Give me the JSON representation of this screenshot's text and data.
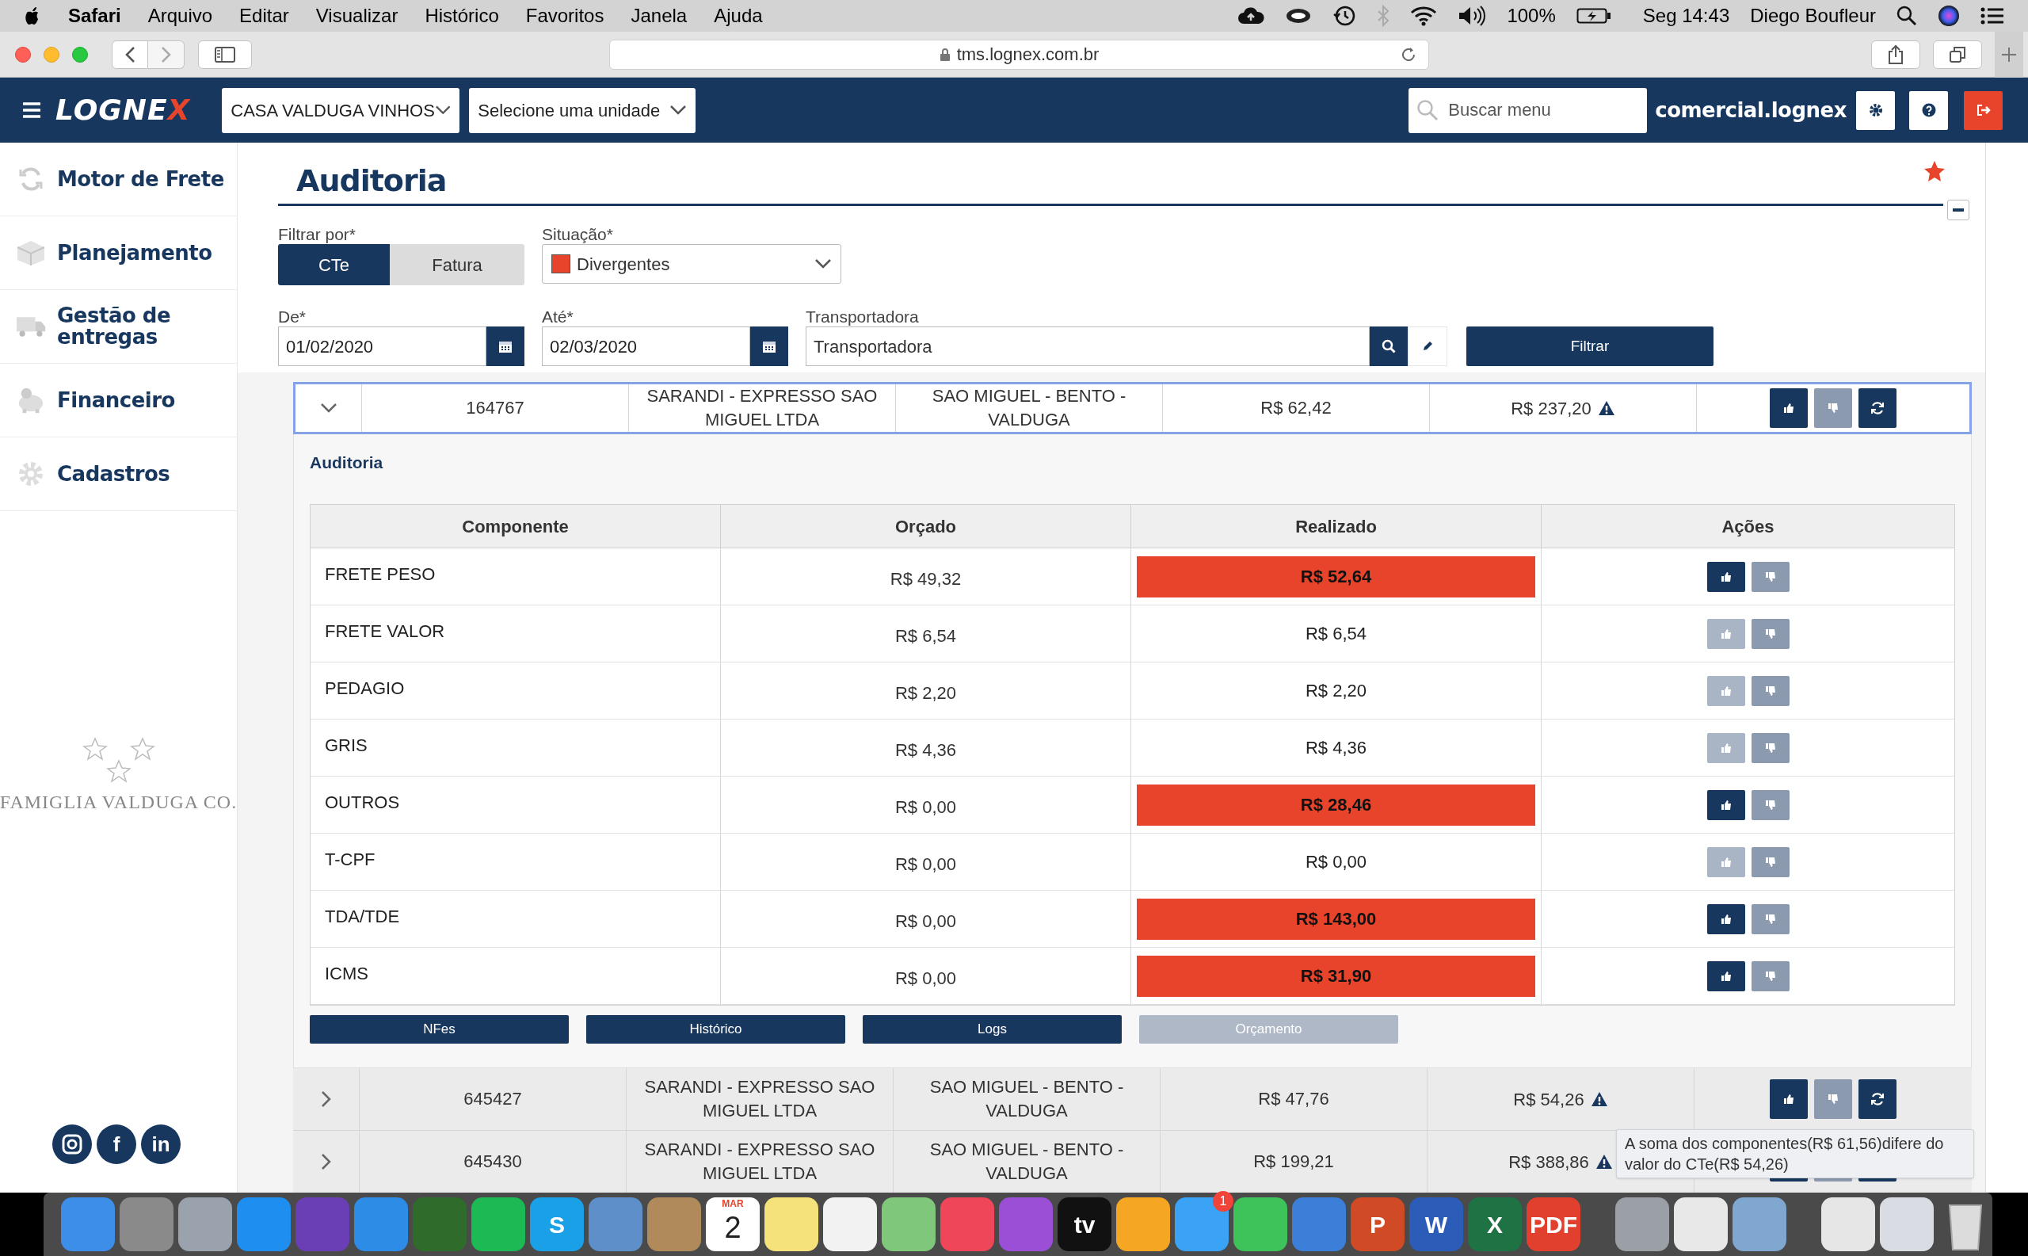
{
  "menu_bar": {
    "app": "Safari",
    "items": [
      "Arquivo",
      "Editar",
      "Visualizar",
      "Histórico",
      "Favoritos",
      "Janela",
      "Ajuda"
    ],
    "battery": "100%",
    "clock": "Seg 14:43",
    "user": "Diego Boufleur"
  },
  "browser": {
    "url": "tms.lognex.com.br"
  },
  "app_header": {
    "logo": "LOGNE",
    "logo_accent": "X",
    "company": "CASA VALDUGA VINHOS",
    "unit_placeholder": "Selecione uma unidade",
    "search_placeholder": "Buscar menu",
    "user": "comercial.lognex"
  },
  "sidebar": {
    "items": [
      {
        "label": "Motor de Frete"
      },
      {
        "label": "Planejamento"
      },
      {
        "label": "Gestão de entregas"
      },
      {
        "label": "Financeiro"
      },
      {
        "label": "Cadastros"
      }
    ],
    "brand": "FAMIGLIA VALDUGA CO.",
    "social": [
      {
        "kind": "camera"
      },
      {
        "kind": "letter",
        "glyph": "f"
      },
      {
        "kind": "letter",
        "glyph": "in"
      }
    ]
  },
  "page": {
    "title": "Auditoria",
    "filter_by": {
      "label": "Filtrar por*",
      "options": [
        {
          "label": "CTe",
          "selected": true
        },
        {
          "label": "Fatura",
          "selected": false
        }
      ]
    },
    "status": {
      "label": "Situação*",
      "value": "Divergentes",
      "color": "#e8442b"
    },
    "from": {
      "label": "De*",
      "value": "01/02/2020"
    },
    "to": {
      "label": "Até*",
      "value": "02/03/2020"
    },
    "carrier": {
      "label": "Transportadora",
      "placeholder": "Transportadora"
    },
    "filter_button": "Filtrar"
  },
  "results": [
    {
      "number": "164767",
      "carrier": "SARANDI - EXPRESSO SAO MIGUEL LTDA",
      "route": "SAO MIGUEL - BENTO - VALDUGA",
      "quoted": "R$ 62,42",
      "actual": "R$ 237,20",
      "warning": true,
      "expanded": true,
      "selected": true
    },
    {
      "number": "645427",
      "carrier": "SARANDI - EXPRESSO SAO MIGUEL LTDA",
      "route": "SAO MIGUEL - BENTO - VALDUGA",
      "quoted": "R$ 47,76",
      "actual": "R$ 54,26",
      "warning": true,
      "expanded": false,
      "selected": false
    },
    {
      "number": "645430",
      "carrier": "SARANDI - EXPRESSO SAO MIGUEL LTDA",
      "route": "SAO MIGUEL - BENTO - VALDUGA",
      "quoted": "R$ 199,21",
      "actual": "R$ 388,86",
      "warning": true,
      "expanded": false,
      "selected": false
    }
  ],
  "audit": {
    "title": "Auditoria",
    "columns": [
      "Componente",
      "Orçado",
      "Realizado",
      "Ações"
    ],
    "rows": [
      {
        "component": "FRETE PESO",
        "quoted": "R$ 49,32",
        "actual": "R$ 52,64",
        "divergent": true
      },
      {
        "component": "FRETE VALOR",
        "quoted": "R$ 6,54",
        "actual": "R$ 6,54",
        "divergent": false
      },
      {
        "component": "PEDAGIO",
        "quoted": "R$ 2,20",
        "actual": "R$ 2,20",
        "divergent": false
      },
      {
        "component": "GRIS",
        "quoted": "R$ 4,36",
        "actual": "R$ 4,36",
        "divergent": false
      },
      {
        "component": "OUTROS",
        "quoted": "R$ 0,00",
        "actual": "R$ 28,46",
        "divergent": true
      },
      {
        "component": "T-CPF",
        "quoted": "R$ 0,00",
        "actual": "R$ 0,00",
        "divergent": false
      },
      {
        "component": "TDA/TDE",
        "quoted": "R$ 0,00",
        "actual": "R$ 143,00",
        "divergent": true
      },
      {
        "component": "ICMS",
        "quoted": "R$ 0,00",
        "actual": "R$ 31,90",
        "divergent": true
      }
    ],
    "buttons": [
      {
        "label": "NFes",
        "disabled": false
      },
      {
        "label": "Histórico",
        "disabled": false
      },
      {
        "label": "Logs",
        "disabled": false
      },
      {
        "label": "Orçamento",
        "disabled": true
      }
    ]
  },
  "tooltip": "A soma dos componentes(R$ 61,56)difere do valor do CTe(R$ 54,26)",
  "dock": [
    {
      "kind": "tile",
      "color": "#3d8ee8"
    },
    {
      "kind": "tile",
      "color": "#8a8a8a"
    },
    {
      "kind": "tile",
      "color": "#9aa3ad"
    },
    {
      "kind": "tile",
      "color": "#1e8ef0"
    },
    {
      "kind": "tile",
      "color": "#6a3fb5"
    },
    {
      "kind": "tile",
      "color": "#2c8ce6"
    },
    {
      "kind": "tile",
      "color": "#2f6b2a"
    },
    {
      "kind": "tile",
      "color": "#1db954"
    },
    {
      "kind": "tile",
      "color": "#1aa0e6",
      "glyph": "S"
    },
    {
      "kind": "tile",
      "color": "#5f8fc9"
    },
    {
      "kind": "tile",
      "color": "#b08a5a"
    },
    {
      "kind": "calendar",
      "month": "MAR",
      "day": "2"
    },
    {
      "kind": "tile",
      "color": "#f5e27a"
    },
    {
      "kind": "tile",
      "color": "#f2f2f2"
    },
    {
      "kind": "tile",
      "color": "#7fc77a"
    },
    {
      "kind": "tile",
      "color": "#f0465a"
    },
    {
      "kind": "tile",
      "color": "#9b4fd6"
    },
    {
      "kind": "tile",
      "color": "#111111",
      "glyph": "tv"
    },
    {
      "kind": "tile",
      "color": "#f5a623"
    },
    {
      "kind": "tile",
      "color": "#3aa3f5",
      "badge": "1"
    },
    {
      "kind": "tile",
      "color": "#3ec25a"
    },
    {
      "kind": "tile",
      "color": "#3b7fd9"
    },
    {
      "kind": "tile",
      "color": "#d04a26",
      "glyph": "P"
    },
    {
      "kind": "tile",
      "color": "#2b5cb8",
      "glyph": "W"
    },
    {
      "kind": "tile",
      "color": "#1f7244",
      "glyph": "X"
    },
    {
      "kind": "tile",
      "color": "#e2402e",
      "glyph": "PDF"
    },
    {
      "kind": "separator"
    },
    {
      "kind": "tile",
      "color": "#9aa0a6"
    },
    {
      "kind": "tile",
      "color": "#e8e8e8"
    },
    {
      "kind": "tile",
      "color": "#7fa7cf"
    },
    {
      "kind": "separator"
    },
    {
      "kind": "tile",
      "color": "#e6e6e6"
    },
    {
      "kind": "tile",
      "color": "#d9dde3"
    },
    {
      "kind": "trash"
    }
  ]
}
